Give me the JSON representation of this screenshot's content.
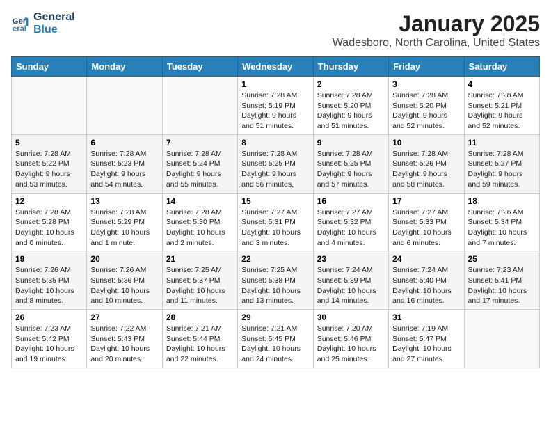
{
  "logo": {
    "line1": "General",
    "line2": "Blue"
  },
  "title": "January 2025",
  "location": "Wadesboro, North Carolina, United States",
  "weekdays": [
    "Sunday",
    "Monday",
    "Tuesday",
    "Wednesday",
    "Thursday",
    "Friday",
    "Saturday"
  ],
  "weeks": [
    [
      {
        "day": "",
        "info": ""
      },
      {
        "day": "",
        "info": ""
      },
      {
        "day": "",
        "info": ""
      },
      {
        "day": "1",
        "info": "Sunrise: 7:28 AM\nSunset: 5:19 PM\nDaylight: 9 hours\nand 51 minutes."
      },
      {
        "day": "2",
        "info": "Sunrise: 7:28 AM\nSunset: 5:20 PM\nDaylight: 9 hours\nand 51 minutes."
      },
      {
        "day": "3",
        "info": "Sunrise: 7:28 AM\nSunset: 5:20 PM\nDaylight: 9 hours\nand 52 minutes."
      },
      {
        "day": "4",
        "info": "Sunrise: 7:28 AM\nSunset: 5:21 PM\nDaylight: 9 hours\nand 52 minutes."
      }
    ],
    [
      {
        "day": "5",
        "info": "Sunrise: 7:28 AM\nSunset: 5:22 PM\nDaylight: 9 hours\nand 53 minutes."
      },
      {
        "day": "6",
        "info": "Sunrise: 7:28 AM\nSunset: 5:23 PM\nDaylight: 9 hours\nand 54 minutes."
      },
      {
        "day": "7",
        "info": "Sunrise: 7:28 AM\nSunset: 5:24 PM\nDaylight: 9 hours\nand 55 minutes."
      },
      {
        "day": "8",
        "info": "Sunrise: 7:28 AM\nSunset: 5:25 PM\nDaylight: 9 hours\nand 56 minutes."
      },
      {
        "day": "9",
        "info": "Sunrise: 7:28 AM\nSunset: 5:25 PM\nDaylight: 9 hours\nand 57 minutes."
      },
      {
        "day": "10",
        "info": "Sunrise: 7:28 AM\nSunset: 5:26 PM\nDaylight: 9 hours\nand 58 minutes."
      },
      {
        "day": "11",
        "info": "Sunrise: 7:28 AM\nSunset: 5:27 PM\nDaylight: 9 hours\nand 59 minutes."
      }
    ],
    [
      {
        "day": "12",
        "info": "Sunrise: 7:28 AM\nSunset: 5:28 PM\nDaylight: 10 hours\nand 0 minutes."
      },
      {
        "day": "13",
        "info": "Sunrise: 7:28 AM\nSunset: 5:29 PM\nDaylight: 10 hours\nand 1 minute."
      },
      {
        "day": "14",
        "info": "Sunrise: 7:28 AM\nSunset: 5:30 PM\nDaylight: 10 hours\nand 2 minutes."
      },
      {
        "day": "15",
        "info": "Sunrise: 7:27 AM\nSunset: 5:31 PM\nDaylight: 10 hours\nand 3 minutes."
      },
      {
        "day": "16",
        "info": "Sunrise: 7:27 AM\nSunset: 5:32 PM\nDaylight: 10 hours\nand 4 minutes."
      },
      {
        "day": "17",
        "info": "Sunrise: 7:27 AM\nSunset: 5:33 PM\nDaylight: 10 hours\nand 6 minutes."
      },
      {
        "day": "18",
        "info": "Sunrise: 7:26 AM\nSunset: 5:34 PM\nDaylight: 10 hours\nand 7 minutes."
      }
    ],
    [
      {
        "day": "19",
        "info": "Sunrise: 7:26 AM\nSunset: 5:35 PM\nDaylight: 10 hours\nand 8 minutes."
      },
      {
        "day": "20",
        "info": "Sunrise: 7:26 AM\nSunset: 5:36 PM\nDaylight: 10 hours\nand 10 minutes."
      },
      {
        "day": "21",
        "info": "Sunrise: 7:25 AM\nSunset: 5:37 PM\nDaylight: 10 hours\nand 11 minutes."
      },
      {
        "day": "22",
        "info": "Sunrise: 7:25 AM\nSunset: 5:38 PM\nDaylight: 10 hours\nand 13 minutes."
      },
      {
        "day": "23",
        "info": "Sunrise: 7:24 AM\nSunset: 5:39 PM\nDaylight: 10 hours\nand 14 minutes."
      },
      {
        "day": "24",
        "info": "Sunrise: 7:24 AM\nSunset: 5:40 PM\nDaylight: 10 hours\nand 16 minutes."
      },
      {
        "day": "25",
        "info": "Sunrise: 7:23 AM\nSunset: 5:41 PM\nDaylight: 10 hours\nand 17 minutes."
      }
    ],
    [
      {
        "day": "26",
        "info": "Sunrise: 7:23 AM\nSunset: 5:42 PM\nDaylight: 10 hours\nand 19 minutes."
      },
      {
        "day": "27",
        "info": "Sunrise: 7:22 AM\nSunset: 5:43 PM\nDaylight: 10 hours\nand 20 minutes."
      },
      {
        "day": "28",
        "info": "Sunrise: 7:21 AM\nSunset: 5:44 PM\nDaylight: 10 hours\nand 22 minutes."
      },
      {
        "day": "29",
        "info": "Sunrise: 7:21 AM\nSunset: 5:45 PM\nDaylight: 10 hours\nand 24 minutes."
      },
      {
        "day": "30",
        "info": "Sunrise: 7:20 AM\nSunset: 5:46 PM\nDaylight: 10 hours\nand 25 minutes."
      },
      {
        "day": "31",
        "info": "Sunrise: 7:19 AM\nSunset: 5:47 PM\nDaylight: 10 hours\nand 27 minutes."
      },
      {
        "day": "",
        "info": ""
      }
    ]
  ]
}
